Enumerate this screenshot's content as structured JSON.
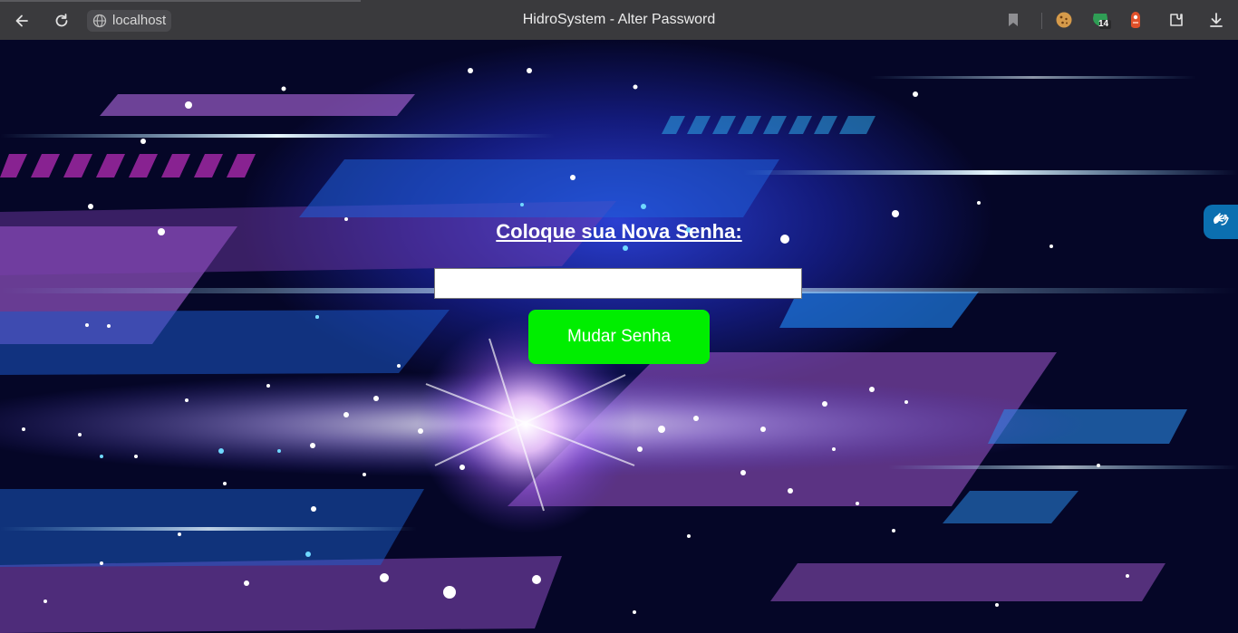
{
  "browser": {
    "address": "localhost",
    "window_title": "HidroSystem - Alter Password",
    "extension_badge": "14",
    "icons": [
      "back-icon",
      "reload-icon",
      "globe-icon",
      "bookmark-icon",
      "cookie-icon",
      "shield-extension-icon",
      "fox-extension-icon",
      "extensions-icon",
      "download-icon"
    ]
  },
  "form": {
    "heading": "Coloque sua Nova Senha:",
    "password_value": "",
    "submit_label": "Mudar Senha"
  },
  "colors": {
    "button_bg": "#00ee00",
    "button_text": "#ffffff",
    "heading_text": "#ffffff",
    "chrome_bg": "#3a3a3d",
    "accessibility_widget": "#0b6fb0"
  }
}
